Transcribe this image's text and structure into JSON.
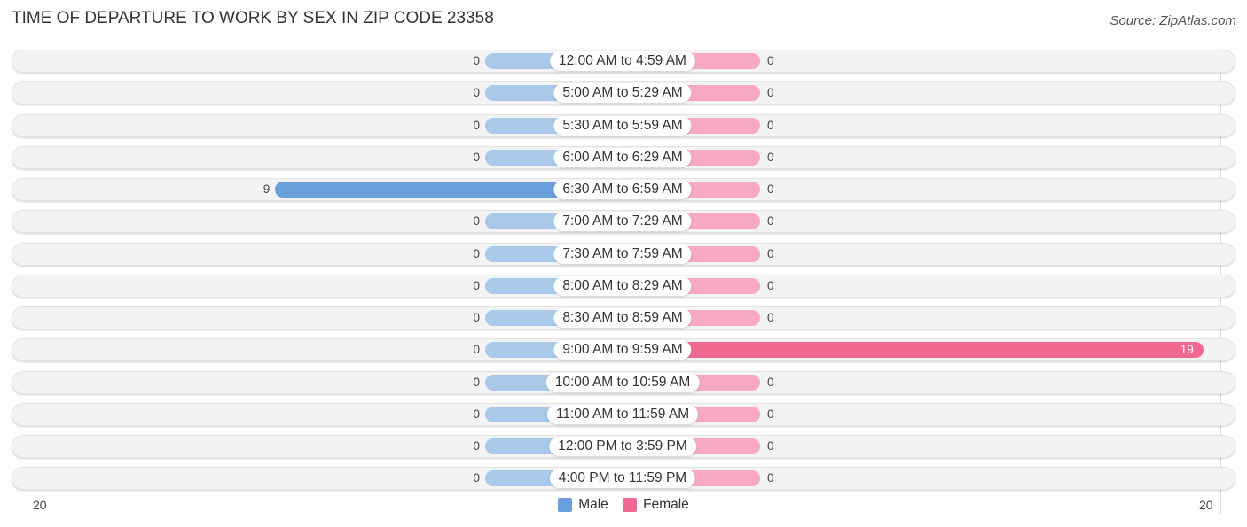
{
  "header": {
    "title": "TIME OF DEPARTURE TO WORK BY SEX IN ZIP CODE 23358",
    "source": "Source: ZipAtlas.com"
  },
  "colors": {
    "male": "#6a9fdb",
    "male_light": "#a9c8ea",
    "female": "#f06792",
    "female_light": "#f6a9c1"
  },
  "chart_data": {
    "type": "bar",
    "orientation": "horizontal-diverging",
    "title": "TIME OF DEPARTURE TO WORK BY SEX IN ZIP CODE 23358",
    "categories": [
      "12:00 AM to 4:59 AM",
      "5:00 AM to 5:29 AM",
      "5:30 AM to 5:59 AM",
      "6:00 AM to 6:29 AM",
      "6:30 AM to 6:59 AM",
      "7:00 AM to 7:29 AM",
      "7:30 AM to 7:59 AM",
      "8:00 AM to 8:29 AM",
      "8:30 AM to 8:59 AM",
      "9:00 AM to 9:59 AM",
      "10:00 AM to 10:59 AM",
      "11:00 AM to 11:59 AM",
      "12:00 PM to 3:59 PM",
      "4:00 PM to 11:59 PM"
    ],
    "series": [
      {
        "name": "Male",
        "values": [
          0,
          0,
          0,
          0,
          9,
          0,
          0,
          0,
          0,
          0,
          0,
          0,
          0,
          0
        ]
      },
      {
        "name": "Female",
        "values": [
          0,
          0,
          0,
          0,
          0,
          0,
          0,
          0,
          0,
          19,
          0,
          0,
          0,
          0
        ]
      }
    ],
    "xlim": [
      -20,
      20
    ],
    "axis_tick_labels": {
      "left": "20",
      "right": "20"
    },
    "legend": {
      "entries": [
        "Male",
        "Female"
      ],
      "placement": "bottom-center"
    },
    "grid": false
  }
}
